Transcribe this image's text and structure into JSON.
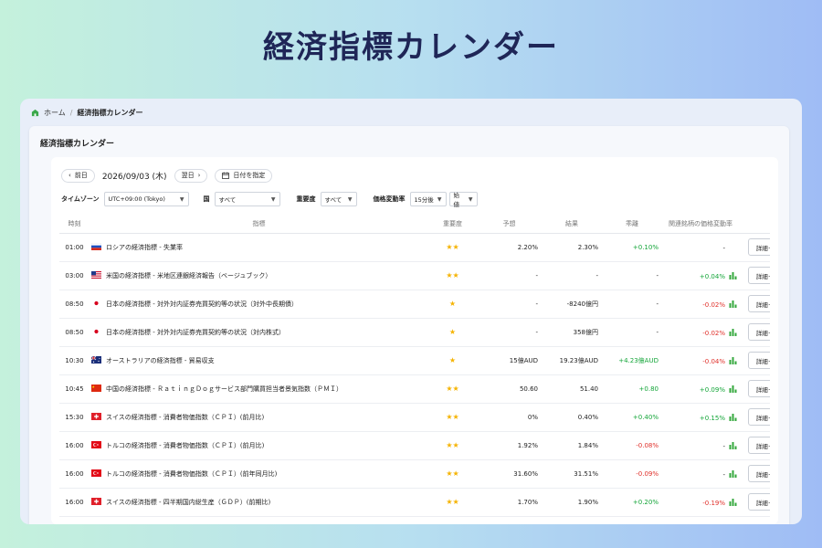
{
  "hero_title": "経済指標カレンダー",
  "breadcrumb": {
    "home": "ホーム",
    "separator": "/",
    "current": "経済指標カレンダー"
  },
  "panel_title": "経済指標カレンダー",
  "datebar": {
    "prev": "前日",
    "date": "2026/09/03 (木)",
    "next": "翌日",
    "specify": "日付を指定"
  },
  "filters": {
    "timezone_label": "タイムゾーン",
    "timezone_value": "UTC+09:00 (Tokyo)",
    "country_label": "国",
    "country_value": "すべて",
    "importance_label": "重要度",
    "importance_value": "すべて",
    "pricechange_label": "価格変動率",
    "pricechange_value1": "15分後",
    "pricechange_value2": "始値"
  },
  "columns": [
    "時刻",
    "指標",
    "重要度",
    "予想",
    "結果",
    "乖離",
    "関連銘柄の価格変動率"
  ],
  "rows": [
    {
      "time": "01:00",
      "flag": "ru",
      "indicator": "ロシアの経済指標 - 失業率",
      "stars": "★★",
      "forecast": "2.20%",
      "result": "2.30%",
      "deviation": "+0.10%",
      "dev_dir": "pos",
      "price_change": "-",
      "pc_dir": "none",
      "chart": false,
      "detail": "詳細＋"
    },
    {
      "time": "03:00",
      "flag": "us",
      "indicator": "米国の経済指標 - 米地区連銀経済報告（ベージュブック）",
      "stars": "★★",
      "forecast": "-",
      "result": "-",
      "deviation": "-",
      "dev_dir": "none",
      "price_change": "+0.04%",
      "pc_dir": "pos",
      "chart": true,
      "detail": "詳細＋"
    },
    {
      "time": "08:50",
      "flag": "jp",
      "indicator": "日本の経済指標 - 対外対内証券売買契約等の状況（対外中長期債）",
      "stars": "★",
      "forecast": "-",
      "result": "-8240億円",
      "deviation": "-",
      "dev_dir": "none",
      "price_change": "-0.02%",
      "pc_dir": "neg",
      "chart": true,
      "detail": "詳細＋"
    },
    {
      "time": "08:50",
      "flag": "jp",
      "indicator": "日本の経済指標 - 対外対内証券売買契約等の状況（対内株式）",
      "stars": "★",
      "forecast": "-",
      "result": "358億円",
      "deviation": "-",
      "dev_dir": "none",
      "price_change": "-0.02%",
      "pc_dir": "neg",
      "chart": true,
      "detail": "詳細＋"
    },
    {
      "time": "10:30",
      "flag": "au",
      "indicator": "オーストラリアの経済指標 - 貿易収支",
      "stars": "★",
      "forecast": "15億AUD",
      "result": "19.23億AUD",
      "deviation": "+4.23億AUD",
      "dev_dir": "pos",
      "price_change": "-0.04%",
      "pc_dir": "neg",
      "chart": true,
      "detail": "詳細＋"
    },
    {
      "time": "10:45",
      "flag": "cn",
      "indicator": "中国の経済指標 - ＲａｔｉｎｇＤｏｇサービス部門購買担当者景気指数（ＰＭＩ）",
      "stars": "★★",
      "forecast": "50.60",
      "result": "51.40",
      "deviation": "+0.80",
      "dev_dir": "pos",
      "price_change": "+0.09%",
      "pc_dir": "pos",
      "chart": true,
      "detail": "詳細＋"
    },
    {
      "time": "15:30",
      "flag": "ch",
      "indicator": "スイスの経済指標 - 消費者物価指数（ＣＰＩ）(前月比)",
      "stars": "★★",
      "forecast": "0%",
      "result": "0.40%",
      "deviation": "+0.40%",
      "dev_dir": "pos",
      "price_change": "+0.15%",
      "pc_dir": "pos",
      "chart": true,
      "detail": "詳細＋"
    },
    {
      "time": "16:00",
      "flag": "tr",
      "indicator": "トルコの経済指標 - 消費者物価指数（ＣＰＩ）(前月比)",
      "stars": "★★",
      "forecast": "1.92%",
      "result": "1.84%",
      "deviation": "-0.08%",
      "dev_dir": "neg",
      "price_change": "-",
      "pc_dir": "none",
      "chart": true,
      "detail": "詳細＋"
    },
    {
      "time": "16:00",
      "flag": "tr",
      "indicator": "トルコの経済指標 - 消費者物価指数（ＣＰＩ）(前年同月比)",
      "stars": "★★",
      "forecast": "31.60%",
      "result": "31.51%",
      "deviation": "-0.09%",
      "dev_dir": "neg",
      "price_change": "-",
      "pc_dir": "none",
      "chart": true,
      "detail": "詳細＋"
    },
    {
      "time": "16:00",
      "flag": "ch",
      "indicator": "スイスの経済指標 - 四半期国内総生産（ＧＤＰ）(前期比)",
      "stars": "★★",
      "forecast": "1.70%",
      "result": "1.90%",
      "deviation": "+0.20%",
      "dev_dir": "pos",
      "price_change": "-0.19%",
      "pc_dir": "neg",
      "chart": true,
      "detail": "詳細＋"
    }
  ],
  "colors": {
    "positive": "#13a538",
    "negative": "#e0302a",
    "star": "#f5b301",
    "title": "#1f2657",
    "bars": "#35a83e"
  }
}
